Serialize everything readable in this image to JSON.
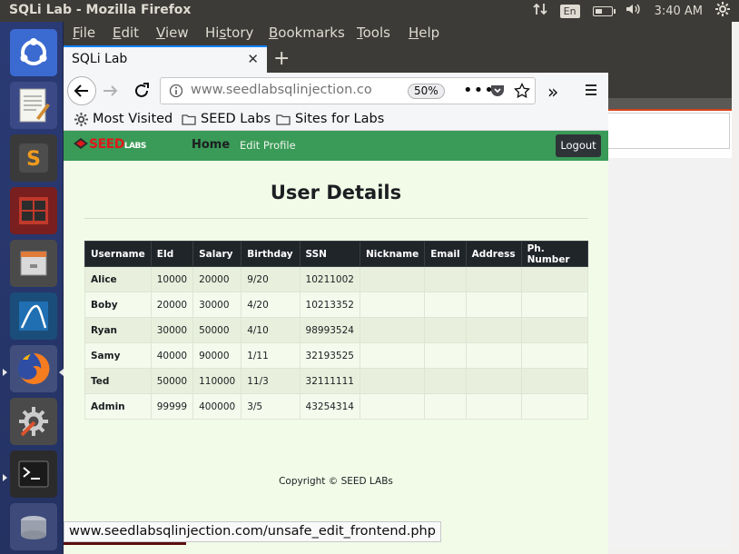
{
  "system": {
    "window_title": "SQLi Lab - Mozilla Firefox",
    "keyboard_layout": "En",
    "clock": "3:40 AM"
  },
  "launcher": {
    "items": [
      "ubuntu-dash",
      "text-editor",
      "sublime-text",
      "calculator-app",
      "file-manager",
      "wireshark",
      "firefox",
      "system-settings",
      "terminal",
      "disk"
    ]
  },
  "browser": {
    "menu": [
      "File",
      "Edit",
      "View",
      "History",
      "Bookmarks",
      "Tools",
      "Help"
    ],
    "tab_title": "SQLi Lab",
    "url": "www.seedlabsqlinjection.com",
    "zoom": "50%",
    "bookmarks": [
      "Most Visited",
      "SEED Labs",
      "Sites for Labs"
    ],
    "status_url": "www.seedlabsqlinjection.com/unsafe_edit_frontend.php"
  },
  "site": {
    "logo_red": "SEED",
    "logo_white": "LABS",
    "nav_home": "Home",
    "nav_edit": "Edit Profile",
    "logout": "Logout",
    "title": "User Details",
    "copyright": "Copyright © SEED LABs",
    "colors": {
      "nav_green": "#3a9a57",
      "page_bg": "#f1fbe8",
      "header_dark": "#20252a"
    }
  },
  "table": {
    "headers": [
      "Username",
      "EId",
      "Salary",
      "Birthday",
      "SSN",
      "Nickname",
      "Email",
      "Address",
      "Ph. Number"
    ],
    "rows": [
      [
        "Alice",
        "10000",
        "20000",
        "9/20",
        "10211002",
        "",
        "",
        "",
        ""
      ],
      [
        "Boby",
        "20000",
        "30000",
        "4/20",
        "10213352",
        "",
        "",
        "",
        ""
      ],
      [
        "Ryan",
        "30000",
        "50000",
        "4/10",
        "98993524",
        "",
        "",
        "",
        ""
      ],
      [
        "Samy",
        "40000",
        "90000",
        "1/11",
        "32193525",
        "",
        "",
        "",
        ""
      ],
      [
        "Ted",
        "50000",
        "110000",
        "11/3",
        "32111111",
        "",
        "",
        "",
        ""
      ],
      [
        "Admin",
        "99999",
        "400000",
        "3/5",
        "43254314",
        "",
        "",
        "",
        ""
      ]
    ]
  }
}
